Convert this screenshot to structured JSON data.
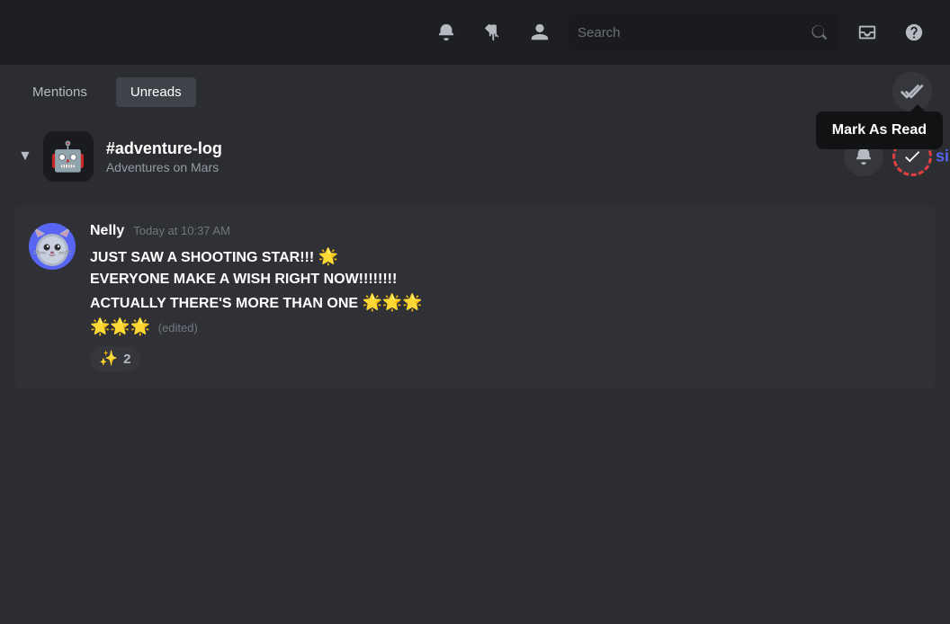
{
  "topbar": {
    "search_placeholder": "Search",
    "icons": {
      "bell": "🔔",
      "pin": "📌",
      "person": "👤",
      "inbox": "📥",
      "help": "❓"
    }
  },
  "tabs": {
    "mentions_label": "Mentions",
    "unreads_label": "Unreads",
    "active": "unreads"
  },
  "mark_as_read": {
    "tooltip": "Mark As Read"
  },
  "channel": {
    "name": "#adventure-log",
    "server": "Adventures on Mars",
    "icon_emoji": "🤖"
  },
  "message": {
    "author": "Nelly",
    "time": "Today at 10:37 AM",
    "lines": [
      "JUST SAW A SHOOTING STAR!!! 🌟",
      "EVERYONE MAKE A WISH RIGHT NOW!!!!!!!!",
      "ACTUALLY THERE'S MORE THAN ONE 🌟🌟🌟",
      "🌟🌟🌟 (edited)"
    ],
    "text_line1": "JUST SAW A SHOOTING STAR!!! ",
    "text_line2": "EVERYONE MAKE A WISH RIGHT NOW!!!!!!!!",
    "text_line3": "ACTUALLY THERE'S MORE THAN ONE ",
    "text_line4_emojis": "",
    "edited_label": "(edited)",
    "reaction_emoji": "✨",
    "reaction_count": "2"
  },
  "partial_right_text": "sin"
}
